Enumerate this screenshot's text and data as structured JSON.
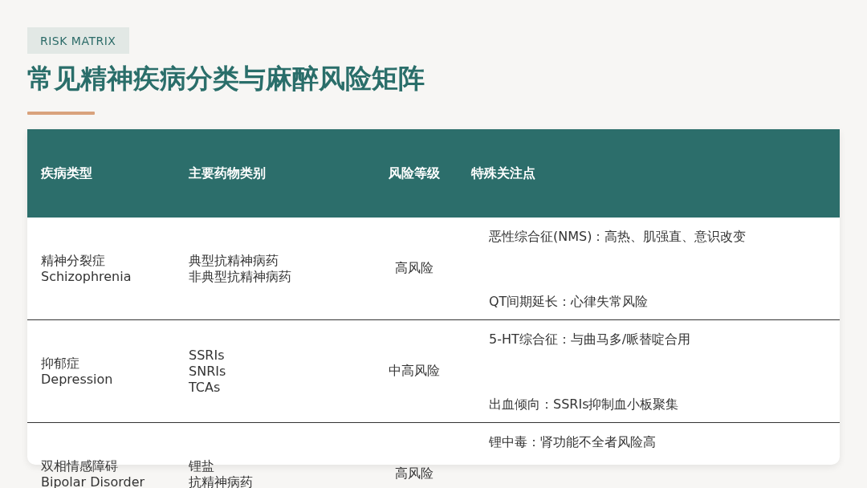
{
  "tag": "RISK MATRIX",
  "title": "常见精神疾病分类与麻醉风险矩阵",
  "table": {
    "columns": [
      "疾病类型",
      "主要药物类别",
      "风险等级",
      "特殊关注点"
    ],
    "rows": [
      {
        "disease": [
          "精神分裂症",
          "Schizophrenia"
        ],
        "drugs": [
          "典型抗精神病药",
          "非典型抗精神病药"
        ],
        "risk": "高风险",
        "notes": [
          "恶性综合征(NMS)：高热、肌强直、意识改变",
          "QT间期延长：心律失常风险"
        ]
      },
      {
        "disease": [
          "抑郁症",
          "Depression"
        ],
        "drugs": [
          "SSRIs",
          "SNRIs",
          "TCAs"
        ],
        "risk": "中高风险",
        "notes": [
          "5-HT综合征：与曲马多/哌替啶合用",
          "出血倾向：SSRIs抑制血小板聚集"
        ]
      },
      {
        "disease": [
          "双相情感障碍",
          "Bipolar Disorder"
        ],
        "drugs": [
          "锂盐",
          "抗精神病药"
        ],
        "risk": "高风险",
        "notes": [
          "锂中毒：肾功能不全者风险高"
        ]
      }
    ]
  }
}
